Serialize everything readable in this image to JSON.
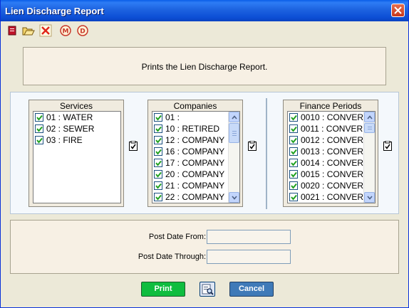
{
  "window": {
    "title": "Lien Discharge Report"
  },
  "toolbar": {
    "icons": [
      "print-icon",
      "open-folder-icon",
      "delete-x-icon",
      "m-circle-icon",
      "d-circle-icon"
    ]
  },
  "description": "Prints the Lien Discharge Report.",
  "services": {
    "header": "Services",
    "items": [
      {
        "label": "01 : WATER",
        "checked": true
      },
      {
        "label": "02 : SEWER",
        "checked": true
      },
      {
        "label": "03 : FIRE",
        "checked": true
      }
    ]
  },
  "companies": {
    "header": "Companies",
    "items": [
      {
        "label": "01 :",
        "checked": true
      },
      {
        "label": "10 : RETIRED",
        "checked": true
      },
      {
        "label": "12 : COMPANY",
        "checked": true
      },
      {
        "label": "16 : COMPANY",
        "checked": true
      },
      {
        "label": "17 : COMPANY",
        "checked": true
      },
      {
        "label": "20 : COMPANY",
        "checked": true
      },
      {
        "label": "21 : COMPANY",
        "checked": true
      },
      {
        "label": "22 : COMPANY",
        "checked": true
      }
    ]
  },
  "finance_periods": {
    "header": "Finance Periods",
    "items": [
      {
        "label": "0010 : CONVER",
        "checked": true
      },
      {
        "label": "0011 : CONVER",
        "checked": true
      },
      {
        "label": "0012 : CONVER",
        "checked": true
      },
      {
        "label": "0013 : CONVER",
        "checked": true
      },
      {
        "label": "0014 : CONVER",
        "checked": true
      },
      {
        "label": "0015 : CONVER",
        "checked": true
      },
      {
        "label": "0020 : CONVER",
        "checked": true
      },
      {
        "label": "0021 : CONVER",
        "checked": true
      }
    ]
  },
  "dates": {
    "from_label": "Post Date From:",
    "from_value": "",
    "through_label": "Post Date Through:",
    "through_value": ""
  },
  "buttons": {
    "print": "Print",
    "cancel": "Cancel"
  },
  "colors": {
    "title_bar": "#0d4fd6",
    "print_button": "#0fbd3f",
    "cancel_button": "#3f7ab8",
    "checkbox_check": "#21a121"
  }
}
